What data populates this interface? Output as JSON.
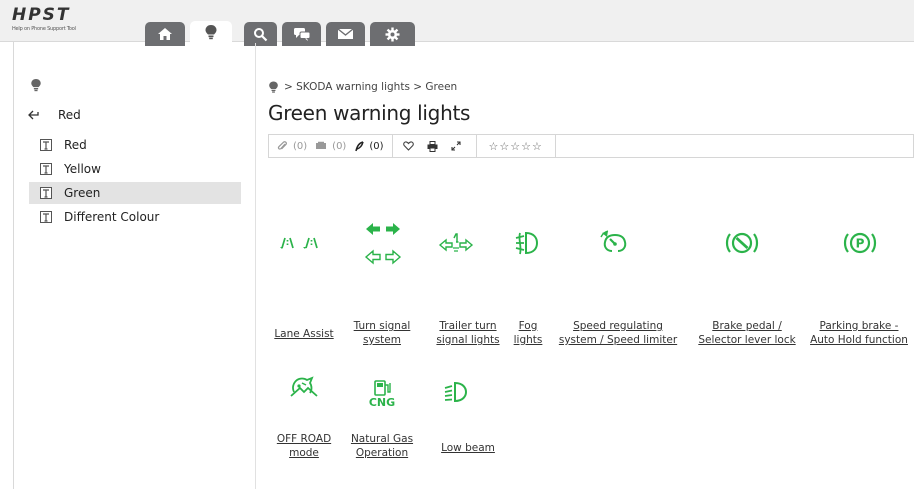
{
  "app": {
    "logo_title": "HPST",
    "logo_subtitle": "Help on Phone Support Tool"
  },
  "nav": {
    "tabs": [
      {
        "icon": "home-icon"
      },
      {
        "icon": "lightbulb-icon",
        "active": true
      },
      {
        "icon": "search-icon"
      },
      {
        "icon": "chat-icon"
      },
      {
        "icon": "mail-icon"
      },
      {
        "icon": "gear-icon"
      }
    ]
  },
  "sidebar": {
    "back_label": "Red",
    "items": [
      {
        "label": "Red"
      },
      {
        "label": "Yellow"
      },
      {
        "label": "Green",
        "selected": true
      },
      {
        "label": "Different Colour"
      }
    ]
  },
  "breadcrumb": {
    "text": "> SKODA warning lights > Green"
  },
  "page": {
    "title": "Green warning lights"
  },
  "toolbar": {
    "attachments": "(0)",
    "comments": "(0)",
    "feedback": "(0)",
    "stars": "☆☆☆☆☆"
  },
  "lights": [
    {
      "label_line1": "Lane Assist",
      "label_line2": ""
    },
    {
      "label_line1": "Turn signal",
      "label_line2": "system"
    },
    {
      "label_line1": "Trailer turn",
      "label_line2": "signal lights"
    },
    {
      "label_line1": "Fog",
      "label_line2": "lights"
    },
    {
      "label_line1": "Speed regulating",
      "label_line2": "system / Speed limiter"
    },
    {
      "label_line1": "Brake pedal /",
      "label_line2": "Selector lever lock"
    },
    {
      "label_line1": "Parking brake -",
      "label_line2": "Auto Hold function"
    },
    {
      "label_line1": "OFF ROAD",
      "label_line2": "mode"
    },
    {
      "label_line1": "Natural Gas",
      "label_line2": "Operation"
    },
    {
      "label_line1": "Low beam",
      "label_line2": ""
    }
  ],
  "icon_text": {
    "cng": "CNG",
    "parking": "P"
  },
  "colors": {
    "accent_green": "#2bb34a",
    "nav_tab": "#6d6e71",
    "selected_row": "#e3e3e3"
  }
}
